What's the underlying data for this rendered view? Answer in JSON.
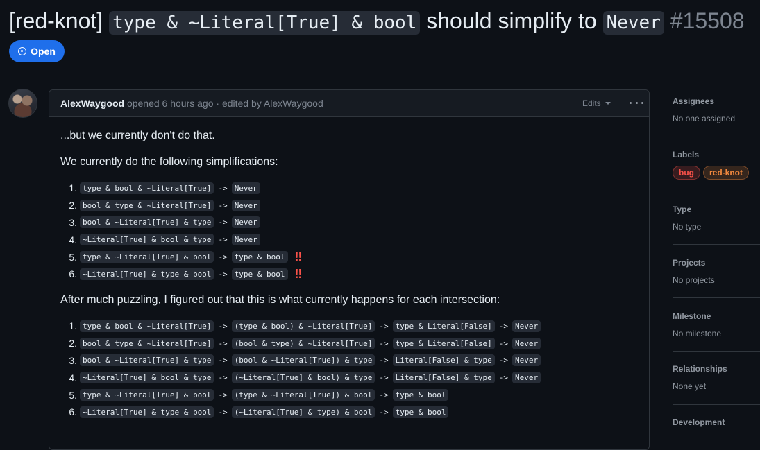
{
  "issue": {
    "title_prefix": "[red-knot]",
    "title_code": "type & ~Literal[True] & bool",
    "title_middle": "should simplify to",
    "title_code2": "Never",
    "number": "#15508",
    "state": "Open"
  },
  "comment": {
    "author": "AlexWaygood",
    "opened": "opened 6 hours ago",
    "edited": "· edited by AlexWaygood",
    "edits_label": "Edits",
    "p1": "...but we currently don't do that.",
    "p2": "We currently do the following simplifications:",
    "p3": "After much puzzling, I figured out that this is what currently happens for each intersection:",
    "list1": [
      {
        "n": "1.",
        "a": "type & bool & ~Literal[True]",
        "b": "Never"
      },
      {
        "n": "2.",
        "a": "bool & type & ~Literal[True]",
        "b": "Never"
      },
      {
        "n": "3.",
        "a": "bool & ~Literal[True] & type",
        "b": "Never"
      },
      {
        "n": "4.",
        "a": "~Literal[True] & bool & type",
        "b": "Never"
      },
      {
        "n": "5.",
        "a": "type & ~Literal[True] & bool",
        "b": "type & bool",
        "flag": "‼"
      },
      {
        "n": "6.",
        "a": "~Literal[True] & type & bool",
        "b": "type & bool",
        "flag": "‼"
      }
    ],
    "list2": [
      {
        "n": "1.",
        "a": "type & bool & ~Literal[True]",
        "b": "(type & bool) & ~Literal[True]",
        "c": "type & Literal[False]",
        "d": "Never"
      },
      {
        "n": "2.",
        "a": "bool & type & ~Literal[True]",
        "b": "(bool & type) & ~Literal[True]",
        "c": "type & Literal[False]",
        "d": "Never"
      },
      {
        "n": "3.",
        "a": "bool & ~Literal[True] & type",
        "b": "(bool & ~Literal[True]) & type",
        "c": "Literal[False] & type",
        "d": "Never"
      },
      {
        "n": "4.",
        "a": "~Literal[True] & bool & type",
        "b": "(~Literal[True] & bool) & type",
        "c": "Literal[False] & type",
        "d": "Never"
      },
      {
        "n": "5.",
        "a": "type & ~Literal[True] & bool",
        "b": "(type & ~Literal[True]) & bool",
        "c": "type & bool"
      },
      {
        "n": "6.",
        "a": "~Literal[True] & type & bool",
        "b": "(~Literal[True] & type) & bool",
        "c": "type & bool"
      }
    ],
    "arrow": "->"
  },
  "sidebar": {
    "assignees_title": "Assignees",
    "assignees_value": "No one assigned",
    "labels_title": "Labels",
    "labels": [
      {
        "name": "bug",
        "color": "#f85149"
      },
      {
        "name": "red-knot",
        "color": "#f0883e"
      }
    ],
    "type_title": "Type",
    "type_value": "No type",
    "projects_title": "Projects",
    "projects_value": "No projects",
    "milestone_title": "Milestone",
    "milestone_value": "No milestone",
    "relationships_title": "Relationships",
    "relationships_value": "None yet",
    "development_title": "Development"
  }
}
